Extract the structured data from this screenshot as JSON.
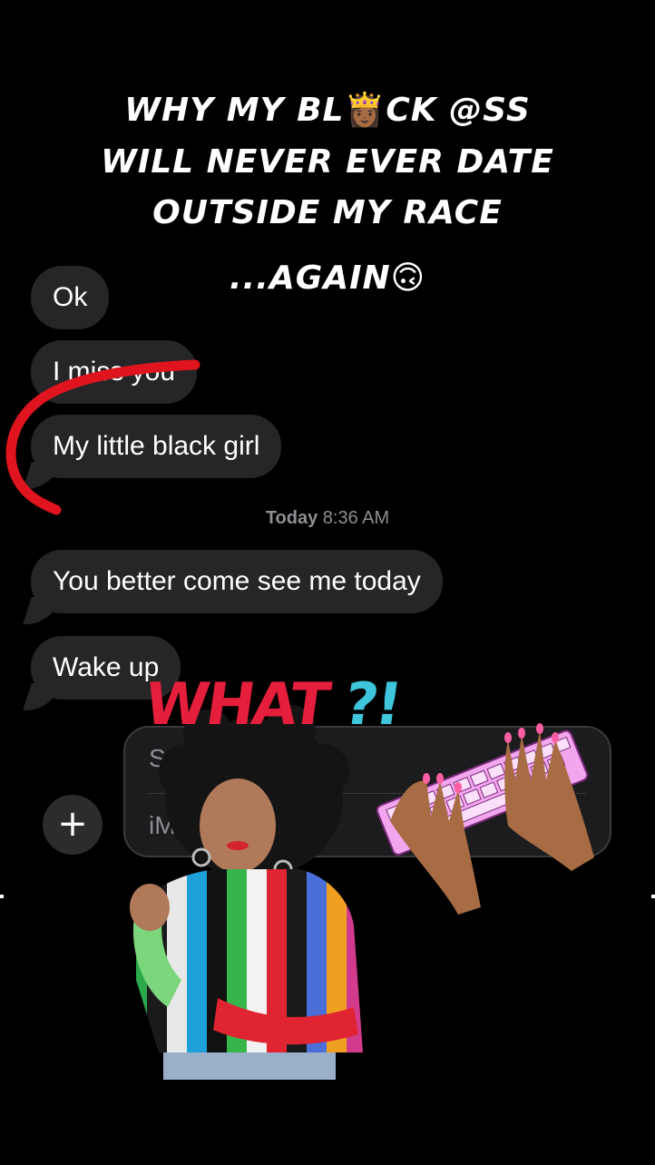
{
  "caption": {
    "line1": "Why my bl",
    "line1_emoji": "👸🏾",
    "line1_end": "ck @ss",
    "line2": "will never ever date",
    "line3": "outside my race",
    "line4": "...again",
    "line4_emoji": "🙃"
  },
  "messages": [
    {
      "text": "Ok"
    },
    {
      "text": "I miss you"
    },
    {
      "text": "My little black girl"
    },
    {
      "text": "You better come see me today"
    },
    {
      "text": "Wake up"
    }
  ],
  "timestamp": {
    "day": "Today",
    "time": "8:36 AM"
  },
  "compose": {
    "subject_placeholder": "Sub",
    "message_placeholder": "iM",
    "plus_icon": "+"
  },
  "sticker": {
    "what": "WHAT",
    "qmark": "?!"
  },
  "colors": {
    "bubble": "#262628",
    "timestamp": "#8e8e93",
    "scribble_red": "#e0141e",
    "what_red": "#e51e3c",
    "what_cyan": "#3fc6dd"
  }
}
